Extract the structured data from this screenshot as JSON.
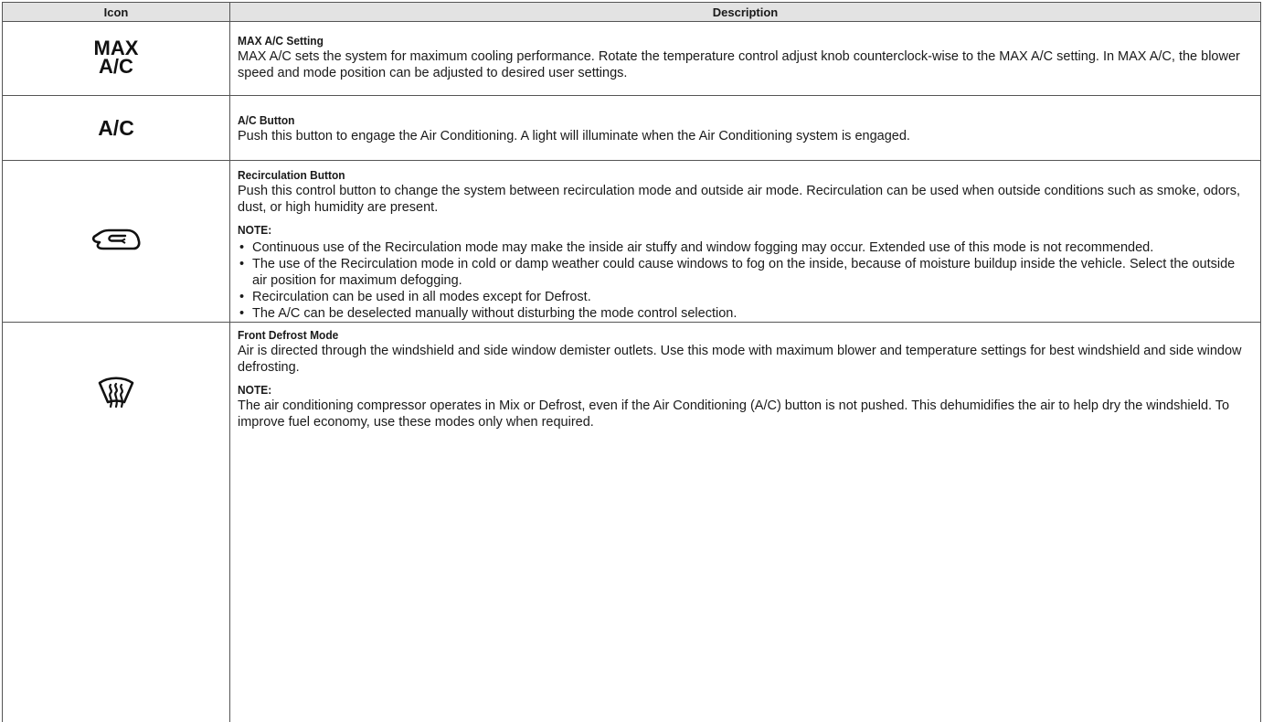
{
  "table": {
    "header": {
      "icon": "Icon",
      "description": "Description"
    },
    "rows": [
      {
        "icon_label": [
          "MAX",
          "A/C"
        ],
        "title": "MAX A/C Setting",
        "text": "MAX A/C sets the system for maximum cooling performance. Rotate the temperature control adjust knob counterclock-wise to the MAX A/C setting. In MAX A/C, the blower speed and mode position can be adjusted to desired user settings."
      },
      {
        "icon_label": "A/C",
        "title": "A/C Button",
        "text": "Push this button to engage the Air Conditioning. A light will illuminate when the Air Conditioning system is engaged."
      },
      {
        "icon": "recirculation-icon",
        "title": "Recirculation Button",
        "text": "Push this control button to change the system between recirculation mode and outside air mode. Recirculation can be used when outside conditions such as smoke, odors, dust, or high humidity are present.",
        "note_label": "NOTE:",
        "bullets": [
          "Continuous use of the Recirculation mode may make the inside air stuffy and window fogging may occur. Extended use of this mode is not recommended.",
          "The use of the Recirculation mode in cold or damp weather could cause windows to fog on the inside, because of moisture buildup inside the vehicle. Select the outside air position for maximum defogging.",
          "Recirculation can be used in all modes except for Defrost.",
          "The A/C can be deselected manually without disturbing the mode control selection."
        ]
      },
      {
        "icon": "front-defrost-icon",
        "title": "Front Defrost Mode",
        "text": "Air is directed through the windshield and side window demister outlets. Use this mode with maximum blower and temperature settings for best windshield and side window defrosting.",
        "note_label": "NOTE:",
        "note_text": "The air conditioning compressor operates in Mix or Defrost, even if the Air Conditioning (A/C) button is not pushed. This dehumidifies the air to help dry the windshield. To improve fuel economy, use these modes only when required."
      }
    ]
  }
}
